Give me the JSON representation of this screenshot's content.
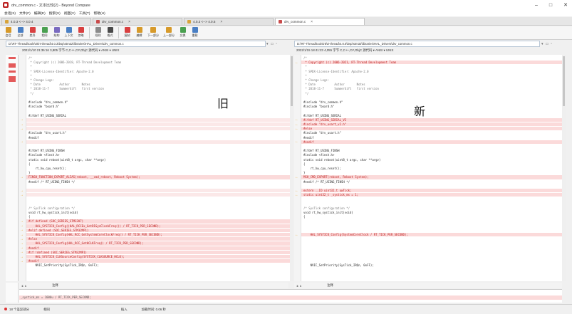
{
  "window": {
    "title": "drv_common.c - 文本比较(2) - Beyond Compare",
    "controls": [
      "–",
      "□",
      "✕"
    ]
  },
  "menu": [
    "会话(S)",
    "文件(F)",
    "编辑(E)",
    "搜索(S)",
    "视图(V)",
    "工具(T)",
    "帮助(H)"
  ],
  "tabs": [
    {
      "label": "4.0.3 <--> 4.0.4",
      "active": false
    },
    {
      "label": "drv_common.c",
      "active": false
    },
    {
      "label": "4.0.3 <--> 4.0.5",
      "active": false
    },
    {
      "label": "drv_common.c",
      "active": true
    }
  ],
  "toolbar": [
    {
      "label": "会话",
      "color": "#d79a2a"
    },
    {
      "label": "全部",
      "color": "#4a7fc4"
    },
    {
      "label": "差异",
      "color": "#d94040"
    },
    {
      "label": "相同",
      "color": "#4aa050"
    },
    {
      "label": "结构",
      "color": "#7a6bc0"
    },
    {
      "label": "上下文",
      "color": "#4a7fc4"
    },
    {
      "label": "忽略",
      "color": "#d94040"
    },
    {
      "label": "规则",
      "color": "#8a8a8a"
    },
    {
      "label": "格式",
      "color": "#4a4a4a"
    },
    {
      "label": "复制",
      "color": "#d94040"
    },
    {
      "label": "编辑",
      "color": "#d79a2a"
    },
    {
      "label": "下一部分",
      "color": "#d79a2a"
    },
    {
      "label": "上一部分",
      "color": "#d79a2a"
    },
    {
      "label": "交换",
      "color": "#4aa050"
    },
    {
      "label": "重载",
      "color": "#4a7fc4"
    }
  ],
  "left": {
    "path": "D:\\RT-Thread\\tools\\rtt\\rt-thread\\4.0.3\\bsp\\stm32\\libraries\\HAL_Drivers\\drv_common.c",
    "info": "2021/1/10 21:36:16   3,805 字节   C,C++,C#,ObjC 源代码 ▾  ANSI ▾  UNIX",
    "label": "旧",
    "position": "1: 1",
    "position_label": "注释",
    "lines": [
      {
        "text": "/*",
        "type": "comment"
      },
      {
        "text": " * Copyright (c) 2006-2018, RT-Thread Development Team",
        "type": "comment"
      },
      {
        "text": " *",
        "type": "comment"
      },
      {
        "text": " * SPDX-License-Identifier: Apache-2.0",
        "type": "comment"
      },
      {
        "text": " *",
        "type": "comment"
      },
      {
        "text": " * Change Logs:",
        "type": "comment"
      },
      {
        "text": " * Date           Author       Notes",
        "type": "comment"
      },
      {
        "text": " * 2018-11-7      SummerGift   first version",
        "type": "comment"
      },
      {
        "text": " */",
        "type": "comment"
      },
      {
        "text": "",
        "type": "normal"
      },
      {
        "text": "#include \"drv_common.h\"",
        "type": "normal"
      },
      {
        "text": "#include \"board.h\"",
        "type": "normal"
      },
      {
        "text": "",
        "type": "normal"
      },
      {
        "text": "#ifdef RT_USING_SERIAL",
        "type": "normal"
      },
      {
        "text": "",
        "type": "empty-diff"
      },
      {
        "text": "",
        "type": "empty-diff"
      },
      {
        "text": "",
        "type": "empty-diff"
      },
      {
        "text": "#include \"drv_usart.h\"",
        "type": "normal"
      },
      {
        "text": "#endif",
        "type": "normal"
      },
      {
        "text": "",
        "type": "empty-diff"
      },
      {
        "text": "",
        "type": "normal"
      },
      {
        "text": "#ifdef RT_USING_FINSH",
        "type": "normal"
      },
      {
        "text": "#include <finsh.h>",
        "type": "normal"
      },
      {
        "text": "static void reboot(uint8_t argc, char **argv)",
        "type": "normal"
      },
      {
        "text": "{",
        "type": "normal"
      },
      {
        "text": "    rt_hw_cpu_reset();",
        "type": "normal"
      },
      {
        "text": "}",
        "type": "normal"
      },
      {
        "text": "FINSH_FUNCTION_EXPORT_ALIAS(reboot, __cmd_reboot, Reboot System);",
        "type": "diff"
      },
      {
        "text": "#endif /* RT_USING_FINSH */",
        "type": "normal"
      },
      {
        "text": "",
        "type": "normal"
      },
      {
        "text": "",
        "type": "empty-diff"
      },
      {
        "text": "",
        "type": "empty-diff"
      },
      {
        "text": "",
        "type": "normal"
      },
      {
        "text": "",
        "type": "normal"
      },
      {
        "text": "/* SysTick configuration */",
        "type": "comment"
      },
      {
        "text": "void rt_hw_systick_init(void)",
        "type": "normal"
      },
      {
        "text": "{",
        "type": "normal"
      },
      {
        "text": "#if defined (SOC_SERIES_STM32H7)",
        "type": "diff"
      },
      {
        "text": "    HAL_SYSTICK_Config((HAL_RCCEx_GetD1SysClockFreq()) / RT_TICK_PER_SECOND);",
        "type": "diff"
      },
      {
        "text": "#elif defined (SOC_SERIES_STM32MP1)",
        "type": "diff"
      },
      {
        "text": "    HAL_SYSTICK_Config(HAL_RCC_GetSystemCoreClockFreq() / RT_TICK_PER_SECOND);",
        "type": "diff"
      },
      {
        "text": "#else",
        "type": "diff"
      },
      {
        "text": "    HAL_SYSTICK_Config(HAL_RCC_GetHCLKFreq() / RT_TICK_PER_SECOND);",
        "type": "diff"
      },
      {
        "text": "#endif",
        "type": "diff"
      },
      {
        "text": "#if !defined (SOC_SERIES_STM32MP1)",
        "type": "diff"
      },
      {
        "text": "    HAL_SYSTICK_CLKSourceConfig(SYSTICK_CLKSOURCE_HCLK);",
        "type": "diff"
      },
      {
        "text": "#endif",
        "type": "diff"
      },
      {
        "text": "    NVIC_SetPriority(SysTick_IRQn, 0xFF);",
        "type": "normal"
      },
      {
        "text": "",
        "type": "normal"
      }
    ]
  },
  "right": {
    "path": "D:\\RT-Thread\\tools\\rtt\\rt-thread\\4.0.5\\bsp\\stm32\\libraries\\HAL_Drivers\\drv_common.c",
    "info": "2022/1/15 18:41:23   4,055 字节   C,C++,C#,ObjC 源代码 ▾  ANSI ▾  UNIX",
    "label": "新",
    "position": "1: 1",
    "position_label": "注释",
    "lines": [
      {
        "text": "/*",
        "type": "comment"
      },
      {
        "text": " * Copyright (c) 2006-2021, RT-Thread Development Team",
        "type": "diff"
      },
      {
        "text": " *",
        "type": "comment"
      },
      {
        "text": " * SPDX-License-Identifier: Apache-2.0",
        "type": "comment"
      },
      {
        "text": " *",
        "type": "comment"
      },
      {
        "text": " * Change Logs:",
        "type": "comment"
      },
      {
        "text": " * Date           Author       Notes",
        "type": "comment"
      },
      {
        "text": " * 2018-11-7      SummerGift   first version",
        "type": "comment"
      },
      {
        "text": " */",
        "type": "comment"
      },
      {
        "text": "",
        "type": "normal"
      },
      {
        "text": "#include \"drv_common.h\"",
        "type": "normal"
      },
      {
        "text": "#include \"board.h\"",
        "type": "normal"
      },
      {
        "text": "",
        "type": "normal"
      },
      {
        "text": "#ifdef RT_USING_SERIAL",
        "type": "normal"
      },
      {
        "text": "#ifdef RT_USING_SERIAL_V2",
        "type": "diff"
      },
      {
        "text": "#include \"drv_usart_v2.h\"",
        "type": "diff"
      },
      {
        "text": "#else",
        "type": "diff"
      },
      {
        "text": "#include \"drv_usart.h\"",
        "type": "normal"
      },
      {
        "text": "#endif",
        "type": "normal"
      },
      {
        "text": "#endif",
        "type": "diff"
      },
      {
        "text": "",
        "type": "normal"
      },
      {
        "text": "#ifdef RT_USING_FINSH",
        "type": "normal"
      },
      {
        "text": "#include <finsh.h>",
        "type": "normal"
      },
      {
        "text": "static void reboot(uint8_t argc, char **argv)",
        "type": "normal"
      },
      {
        "text": "{",
        "type": "normal"
      },
      {
        "text": "    rt_hw_cpu_reset();",
        "type": "normal"
      },
      {
        "text": "}",
        "type": "normal"
      },
      {
        "text": "MSH_CMD_EXPORT(reboot, Reboot System);",
        "type": "diff"
      },
      {
        "text": "#endif /* RT_USING_FINSH */",
        "type": "normal"
      },
      {
        "text": "",
        "type": "normal"
      },
      {
        "text": "extern __IO uint32_t uwTick;",
        "type": "diff"
      },
      {
        "text": "static uint32_t _systick_ms = 1;",
        "type": "diff"
      },
      {
        "text": "",
        "type": "normal"
      },
      {
        "text": "",
        "type": "normal"
      },
      {
        "text": "/* SysTick configuration */",
        "type": "comment"
      },
      {
        "text": "void rt_hw_systick_init(void)",
        "type": "normal"
      },
      {
        "text": "{",
        "type": "normal"
      },
      {
        "text": "",
        "type": "normal"
      },
      {
        "text": "",
        "type": "normal"
      },
      {
        "text": "",
        "type": "normal"
      },
      {
        "text": "    HAL_SYSTICK_Config(SystemCoreClock / RT_TICK_PER_SECOND);",
        "type": "diff"
      },
      {
        "text": "",
        "type": "normal"
      },
      {
        "text": "",
        "type": "normal"
      },
      {
        "text": "",
        "type": "normal"
      },
      {
        "text": "",
        "type": "normal"
      },
      {
        "text": "",
        "type": "normal"
      },
      {
        "text": "",
        "type": "normal"
      },
      {
        "text": "    NVIC_SetPriority(SysTick_IRQn, 0xFF);",
        "type": "normal"
      },
      {
        "text": "",
        "type": "normal"
      }
    ],
    "extra_line": "    _systick_ms = 1000u / RT_TICK_PER_SECOND;"
  },
  "status": {
    "diff_count": "18 个差异部分",
    "mode": "相同",
    "insert": "插入",
    "load_time": "加载时间: 0.06 秒"
  }
}
